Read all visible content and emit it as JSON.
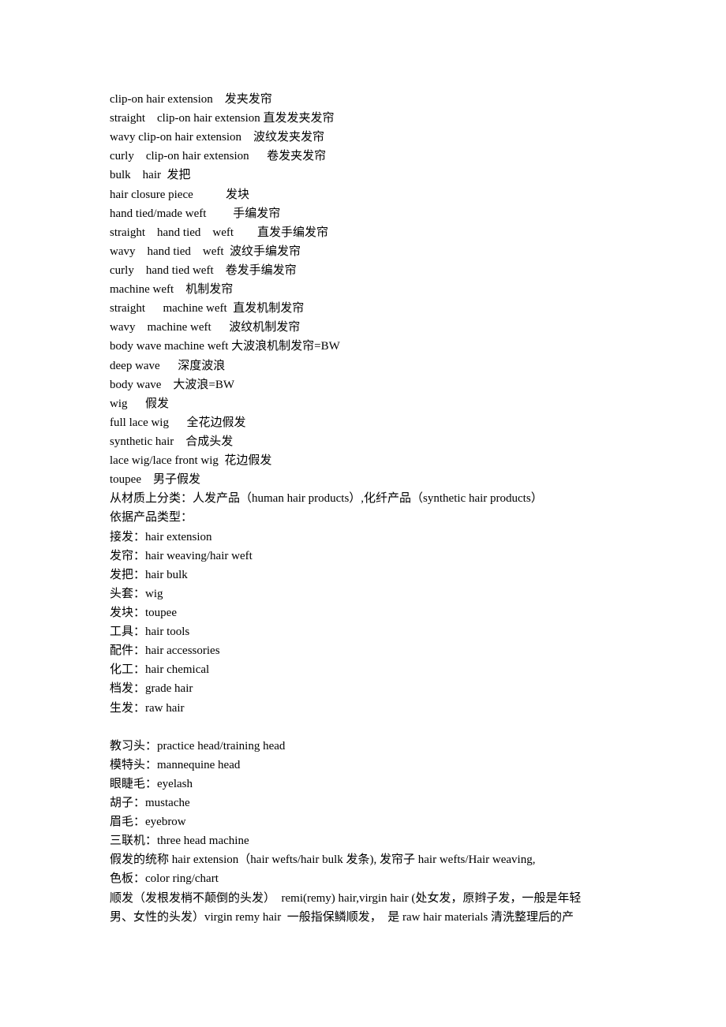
{
  "document": {
    "lines": [
      "clip-on hair extension    发夹发帘",
      "straight    clip-on hair extension 直发发夹发帘",
      "wavy clip-on hair extension    波纹发夹发帘",
      "curly    clip-on hair extension      卷发夹发帘",
      "bulk    hair  发把",
      "hair closure piece           发块",
      "hand tied/made weft         手编发帘",
      "straight    hand tied    weft        直发手编发帘",
      "wavy    hand tied    weft  波纹手编发帘",
      "curly    hand tied weft    卷发手编发帘",
      "machine weft    机制发帘",
      "straight      machine weft  直发机制发帘",
      "wavy    machine weft      波纹机制发帘",
      "body wave machine weft 大波浪机制发帘=BW",
      "deep wave      深度波浪",
      "body wave    大波浪=BW",
      "wig      假发",
      "full lace wig      全花边假发",
      "synthetic hair    合成头发",
      "lace wig/lace front wig  花边假发",
      "toupee    男子假发",
      "从材质上分类：人发产品（human hair products）,化纤产品（synthetic hair products）",
      "依据产品类型：",
      "接发：hair extension",
      "发帘：hair weaving/hair weft",
      "发把：hair bulk",
      "头套：wig",
      "发块：toupee",
      "工具：hair tools",
      "配件：hair accessories",
      "化工：hair chemical",
      "档发：grade hair",
      "生发：raw hair",
      "",
      "教习头：practice head/training head",
      "模特头：mannequine head",
      "眼睫毛：eyelash",
      "胡子：mustache",
      "眉毛：eyebrow",
      "三联机：three head machine",
      "假发的统称 hair extension（hair wefts/hair bulk 发条), 发帘子 hair wefts/Hair weaving,",
      "色板：color ring/chart",
      "顺发（发根发梢不颠倒的头发）  remi(remy) hair,virgin hair (处女发，原辫子发，一般是年轻",
      "男、女性的头发）virgin remy hair  一般指保鳞顺发，  是 raw hair materials 清洗整理后的产"
    ]
  }
}
